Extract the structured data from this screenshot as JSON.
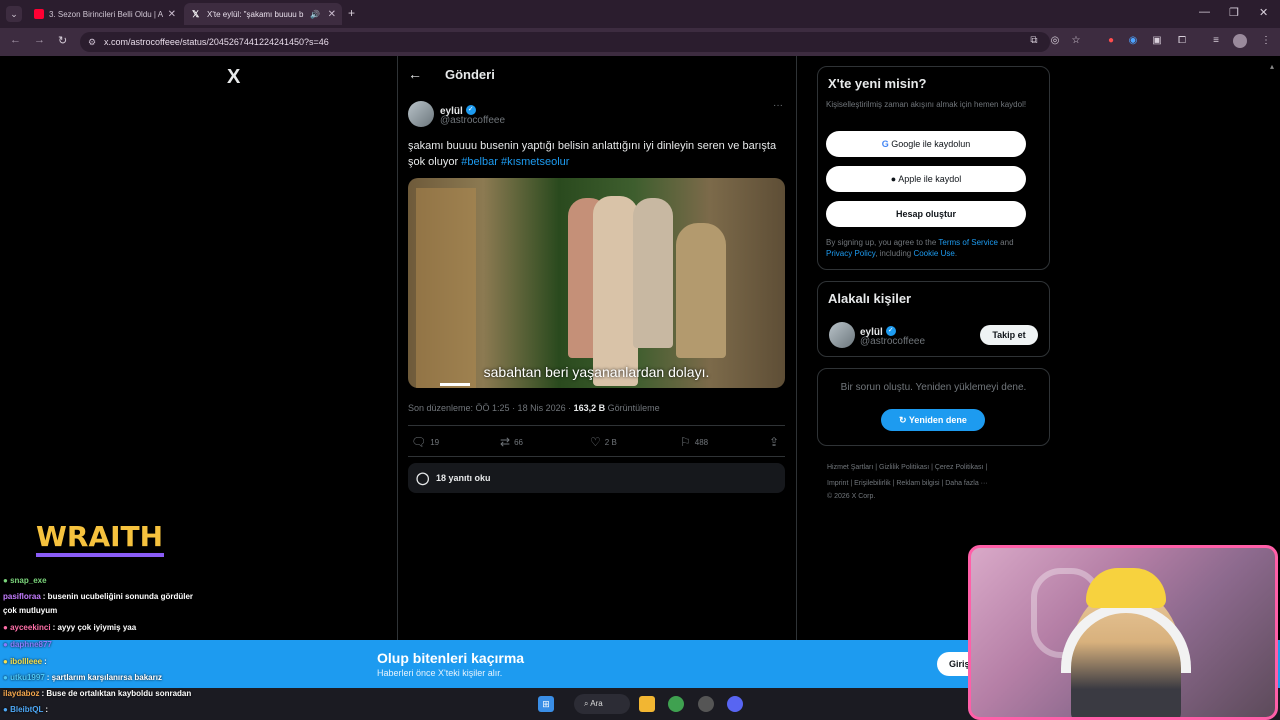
{
  "browser": {
    "tabs": [
      {
        "label": "3. Sezon Birincileri Belli Oldu | A",
        "active": false,
        "favicon_color": "#ff0033"
      },
      {
        "label": "X'te eylül: \"şakamı buuuu b",
        "active": true,
        "favicon_color": "#ffffff"
      }
    ],
    "new_tab": "+",
    "url": "x.com/astrocoffeee/status/2045267441224241450?s=46"
  },
  "x": {
    "logo": "X",
    "header_title": "Gönderi",
    "tweet": {
      "author_name": "eylül",
      "author_handle": "@astrocoffeee",
      "text_main": "şakamı buuuu busenin yaptığı belisin anlattığını iyi dinleyin seren ve barışta şok oluyor ",
      "tag1": "#belbar",
      "tag2": "#kısmetseolur",
      "video_subtitle": "sabahtan beri yaşananlardan dolayı.",
      "meta_prefix": "Son düzenleme: ÖÖ 1:25 · 18 Nis 2026 · ",
      "views_count": "163,2 B",
      "views_label": " Görüntüleme",
      "replies": "19",
      "reposts": "66",
      "likes": "2 B",
      "bookmarks": "488",
      "read_replies": "18 yanıtı oku"
    },
    "signup": {
      "title": "X'te yeni misin?",
      "subtitle": "Kişiselleştirilmiş zaman akışını almak için hemen kaydol!",
      "google": "Google ile kaydolun",
      "apple": "Apple ile kaydol",
      "create": "Hesap oluştur",
      "legal_1": "By signing up, you agree to the ",
      "terms": "Terms of Service",
      "legal_2": " and ",
      "privacy": "Privacy Policy",
      "legal_3": ", including ",
      "cookie": "Cookie Use",
      "legal_4": "."
    },
    "related": {
      "title": "Alakalı kişiler",
      "name": "eylül",
      "handle": "@astrocoffeee",
      "follow": "Takip et"
    },
    "error": {
      "message": "Bir sorun oluştu. Yeniden yüklemeyi dene.",
      "retry": "Yeniden dene"
    },
    "footer": {
      "line1": "Hizmet Şartları  |  Gizlilik Politikası  |  Çerez Politikası  |",
      "line2": "Imprint  |  Erişilebilirlik  |  Reklam bilgisi  |  Daha fazla ···",
      "line3": "© 2026 X Corp."
    },
    "banner": {
      "title": "Olup bitenleri kaçırma",
      "subtitle": "Haberleri önce X'teki kişiler alır.",
      "button": "Giriş"
    }
  },
  "stream": {
    "overlay_logo": "WRAITH",
    "chat": [
      {
        "user": "snap_exe",
        "user_color": "#7cd67c",
        "msg": ""
      },
      {
        "user": "pasifloraa",
        "user_color": "#c47cff",
        "msg": ": busenin ucubeliğini sonunda gördüler"
      },
      {
        "user": "",
        "user_color": "#ffffff",
        "msg": "çok mutluyum"
      },
      {
        "user": "ayceekinci",
        "user_color": "#ff6fa8",
        "msg": ": ayyy çok iyiymiş yaa"
      },
      {
        "user": "daphne877",
        "user_color": "#8a7cff",
        "msg": ""
      },
      {
        "user": "ibollleee",
        "user_color": "#f6e04e",
        "msg": ":"
      },
      {
        "user": "utku1997",
        "user_color": "#4ec8f6",
        "msg": ": şartlarım karşılanırsa bakarız"
      },
      {
        "user": "ilaydaboz",
        "user_color": "#f6a84e",
        "msg": ": Buse de ortalıktan kayboldu sonradan"
      },
      {
        "user": "BleibtQL",
        "user_color": "#4ea8f6",
        "msg": ":"
      }
    ]
  },
  "taskbar": {
    "search": "Ara"
  }
}
